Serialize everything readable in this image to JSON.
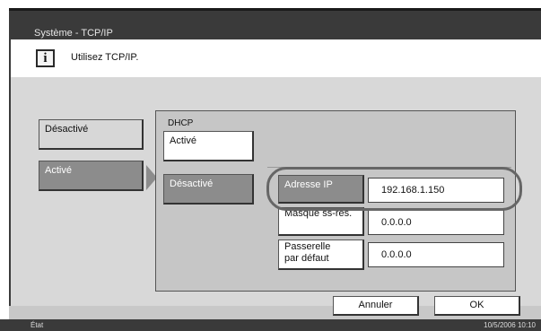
{
  "header": {
    "title": "Système - TCP/IP"
  },
  "message": {
    "icon": "info-icon",
    "text": "Utilisez TCP/IP."
  },
  "tcpip": {
    "off_label": "Désactivé",
    "on_label": "Activé"
  },
  "dhcp": {
    "label": "DHCP",
    "on_label": "Activé",
    "off_label": "Désactivé"
  },
  "ip": {
    "address_label": "Adresse IP",
    "address_value": "192.168.1.150",
    "subnet_label": "Masque ss-rés.",
    "subnet_value": "0.0.0.0",
    "gateway_label": "Passerelle\npar défaut",
    "gateway_value": "0.0.0.0"
  },
  "footer": {
    "cancel_label": "Annuler",
    "ok_label": "OK"
  },
  "status": {
    "state_label": "État",
    "datetime": "10/5/2006  10:10"
  },
  "colors": {
    "selected": "#8c8c8c",
    "panel": "#c6c6c6",
    "bar": "#3a3a3a"
  }
}
